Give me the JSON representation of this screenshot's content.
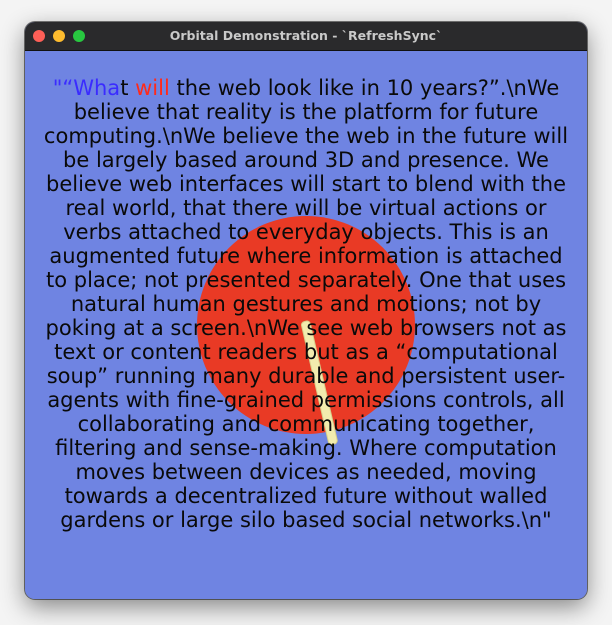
{
  "window": {
    "title": "Orbital Demonstration - `RefreshSync`"
  },
  "content": {
    "quote_open": "\"“",
    "wha": "Wha",
    "t_space": "t ",
    "will": "will",
    "rest": " the web look like in 10 years?”.\\nWe believe that reality is the platform for future computing.\\nWe believe the web in the future will be largely based around 3D and presence. We believe web interfaces will start to blend with the real world, that there will be virtual actions or verbs attached to everyday objects. This is an augmented future where information is attached to place; not presented separately. One that uses natural human gestures and motions; not by poking at a screen.\\nWe see web browsers not as text or content readers but as a “computational soup” running many durable and persistent user-agents with fine-grained permissions controls, all collaborating and communicating together, filtering and sense-making. Where computation moves between devices as needed, moving towards a decentralized future without walled gardens or large silo based social networks.\\n\""
  },
  "colors": {
    "background": "#6f84e2",
    "orb": "#e93a25",
    "hand": "#f2ecae",
    "highlight_blue": "#3a2bff",
    "highlight_red": "#ff2a1a"
  }
}
